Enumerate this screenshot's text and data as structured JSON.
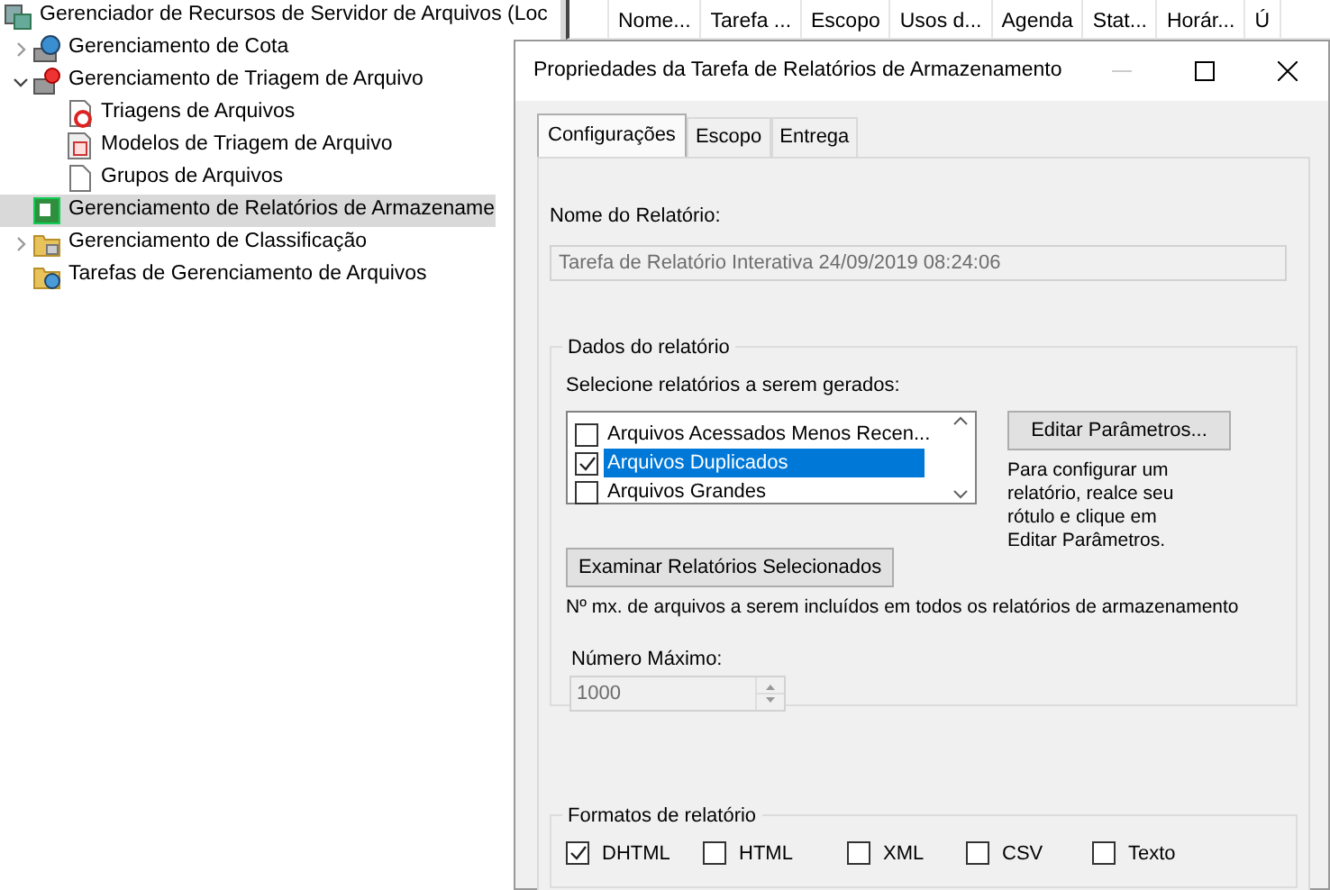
{
  "tree": {
    "items": [
      {
        "label": "Gerenciador de Recursos de Servidor de Arquivos (Loc",
        "kind": "server",
        "selected": false,
        "children": [
          {
            "label": "Gerenciamento de Cota",
            "kind": "quota",
            "selected": false,
            "expanded": false
          },
          {
            "label": "Gerenciamento de Triagem de Arquivo",
            "kind": "screening",
            "selected": false,
            "expanded": true,
            "children": [
              {
                "label": "Triagens de Arquivos",
                "kind": "screen",
                "selected": false
              },
              {
                "label": "Modelos de Triagem de Arquivo",
                "kind": "template",
                "selected": false
              },
              {
                "label": "Grupos de Arquivos",
                "kind": "page",
                "selected": false
              }
            ]
          },
          {
            "label": "Gerenciamento de Relatórios de Armazename",
            "kind": "report",
            "selected": true
          },
          {
            "label": "Gerenciamento de Classificação",
            "kind": "folder",
            "selected": false,
            "expanded": false
          },
          {
            "label": "Tarefas de Gerenciamento de Arquivos",
            "kind": "folder-clock",
            "selected": false
          }
        ]
      }
    ]
  },
  "table": {
    "columns": [
      "Nome...",
      "Tarefa ...",
      "Escopo",
      "Usos d...",
      "Agenda",
      "Stat...",
      "Horár...",
      "Ú"
    ]
  },
  "dialog": {
    "title": "Propriedades da Tarefa de Relatórios de Armazenamento",
    "minimize_disabled": true,
    "tabs": [
      {
        "label": "Configurações",
        "selected": true
      },
      {
        "label": "Escopo",
        "selected": false
      },
      {
        "label": "Entrega",
        "selected": false
      }
    ],
    "report_name": {
      "label": "Nome do Relatório:",
      "value": "Tarefa de Relatório Interativa 24/09/2019 08:24:06",
      "disabled": true
    },
    "report_data": {
      "legend": "Dados do relatório",
      "prompt": "Selecione relatórios a serem gerados:",
      "reports": [
        {
          "label": "Arquivos Acessados Menos Recen...",
          "checked": false,
          "selected": false
        },
        {
          "label": "Arquivos Duplicados",
          "checked": true,
          "selected": true
        },
        {
          "label": "Arquivos Grandes",
          "checked": false,
          "selected": false
        }
      ],
      "edit_button": "Editar Parâmetros...",
      "help": "Para configurar um relatório, realce seu rótulo e clique em Editar Parâmetros.",
      "review_button": "Examinar Relatórios Selecionados",
      "max_note": "Nº mx. de arquivos a serem incluídos em todos os relatórios de armazenamento",
      "max_label": "Número Máximo:",
      "max_value": "1000",
      "max_disabled": true
    },
    "formats": {
      "legend": "Formatos de relatório",
      "options": [
        {
          "label": "DHTML",
          "checked": true
        },
        {
          "label": "HTML",
          "checked": false
        },
        {
          "label": "XML",
          "checked": false
        },
        {
          "label": "CSV",
          "checked": false
        },
        {
          "label": "Texto",
          "checked": false
        }
      ]
    }
  }
}
